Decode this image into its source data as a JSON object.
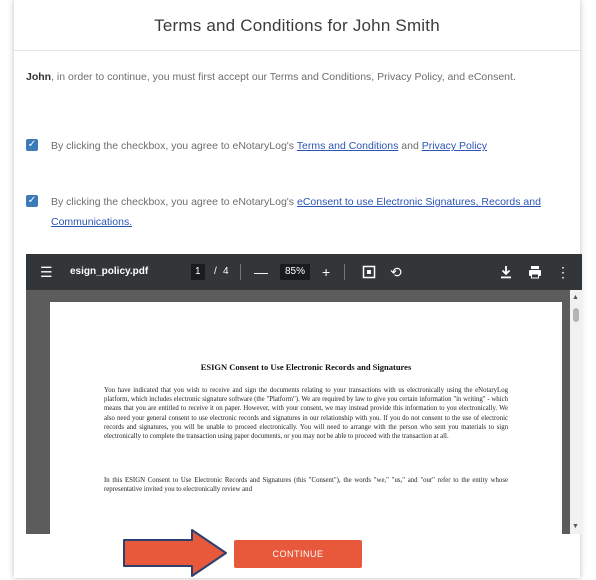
{
  "header": {
    "title": "Terms and Conditions for John Smith"
  },
  "intro": {
    "name": "John",
    "text": ", in order to continue, you must first accept our Terms and Conditions, Privacy Policy, and eConsent."
  },
  "consents": [
    {
      "checked": true,
      "prefix": "By clicking the checkbox, you agree to eNotaryLog's ",
      "link1": "Terms and Conditions",
      "middle": " and ",
      "link2": "Privacy Policy"
    },
    {
      "checked": true,
      "prefix": "By clicking the checkbox, you agree to eNotaryLog's ",
      "link1": "eConsent to use Electronic Signatures, Records and Communications."
    }
  ],
  "pdf_viewer": {
    "filename": "esign_policy.pdf",
    "page_current": "1",
    "page_total": "4",
    "zoom": "85%",
    "doc_title": "ESIGN Consent to Use Electronic Records and Signatures",
    "paragraphs": [
      "You have indicated that you wish to receive and sign the documents relating to your transactions with us electronically using the eNotaryLog platform, which includes electronic signature software (the \"Platform\"). We are required by law to give you certain information \"in writing\" - which means that you are entitled to receive it on paper. However, with your consent, we may instead provide this information to you electronically. We also need your general consent to use electronic records and signatures in our relationship with you. If you do not consent to the use of electronic records and signatures, you will be unable to proceed electronically. You will need to arrange with the person who sent you materials to sign electronically to complete the transaction using paper documents, or you may not be able to proceed with the transaction at all.",
      "In this ESIGN Consent to Use Electronic Records and Signatures (this \"Consent\"), the words \"we,\" \"us,\" and \"our\" refer to the entity whose representative invited you to electronically review and"
    ]
  },
  "actions": {
    "continue_label": "CONTINUE"
  },
  "colors": {
    "accent": "#e8593c",
    "checkbox": "#3d7ab8",
    "link": "#2c55b5",
    "toolbar": "#323639",
    "arrow": "#e8593c"
  },
  "icons": [
    "menu-icon",
    "zoom-out-icon",
    "zoom-in-icon",
    "fit-page-icon",
    "rotate-icon",
    "download-icon",
    "print-icon",
    "more-vert-icon",
    "checkmark-icon",
    "arrow-right-icon"
  ]
}
